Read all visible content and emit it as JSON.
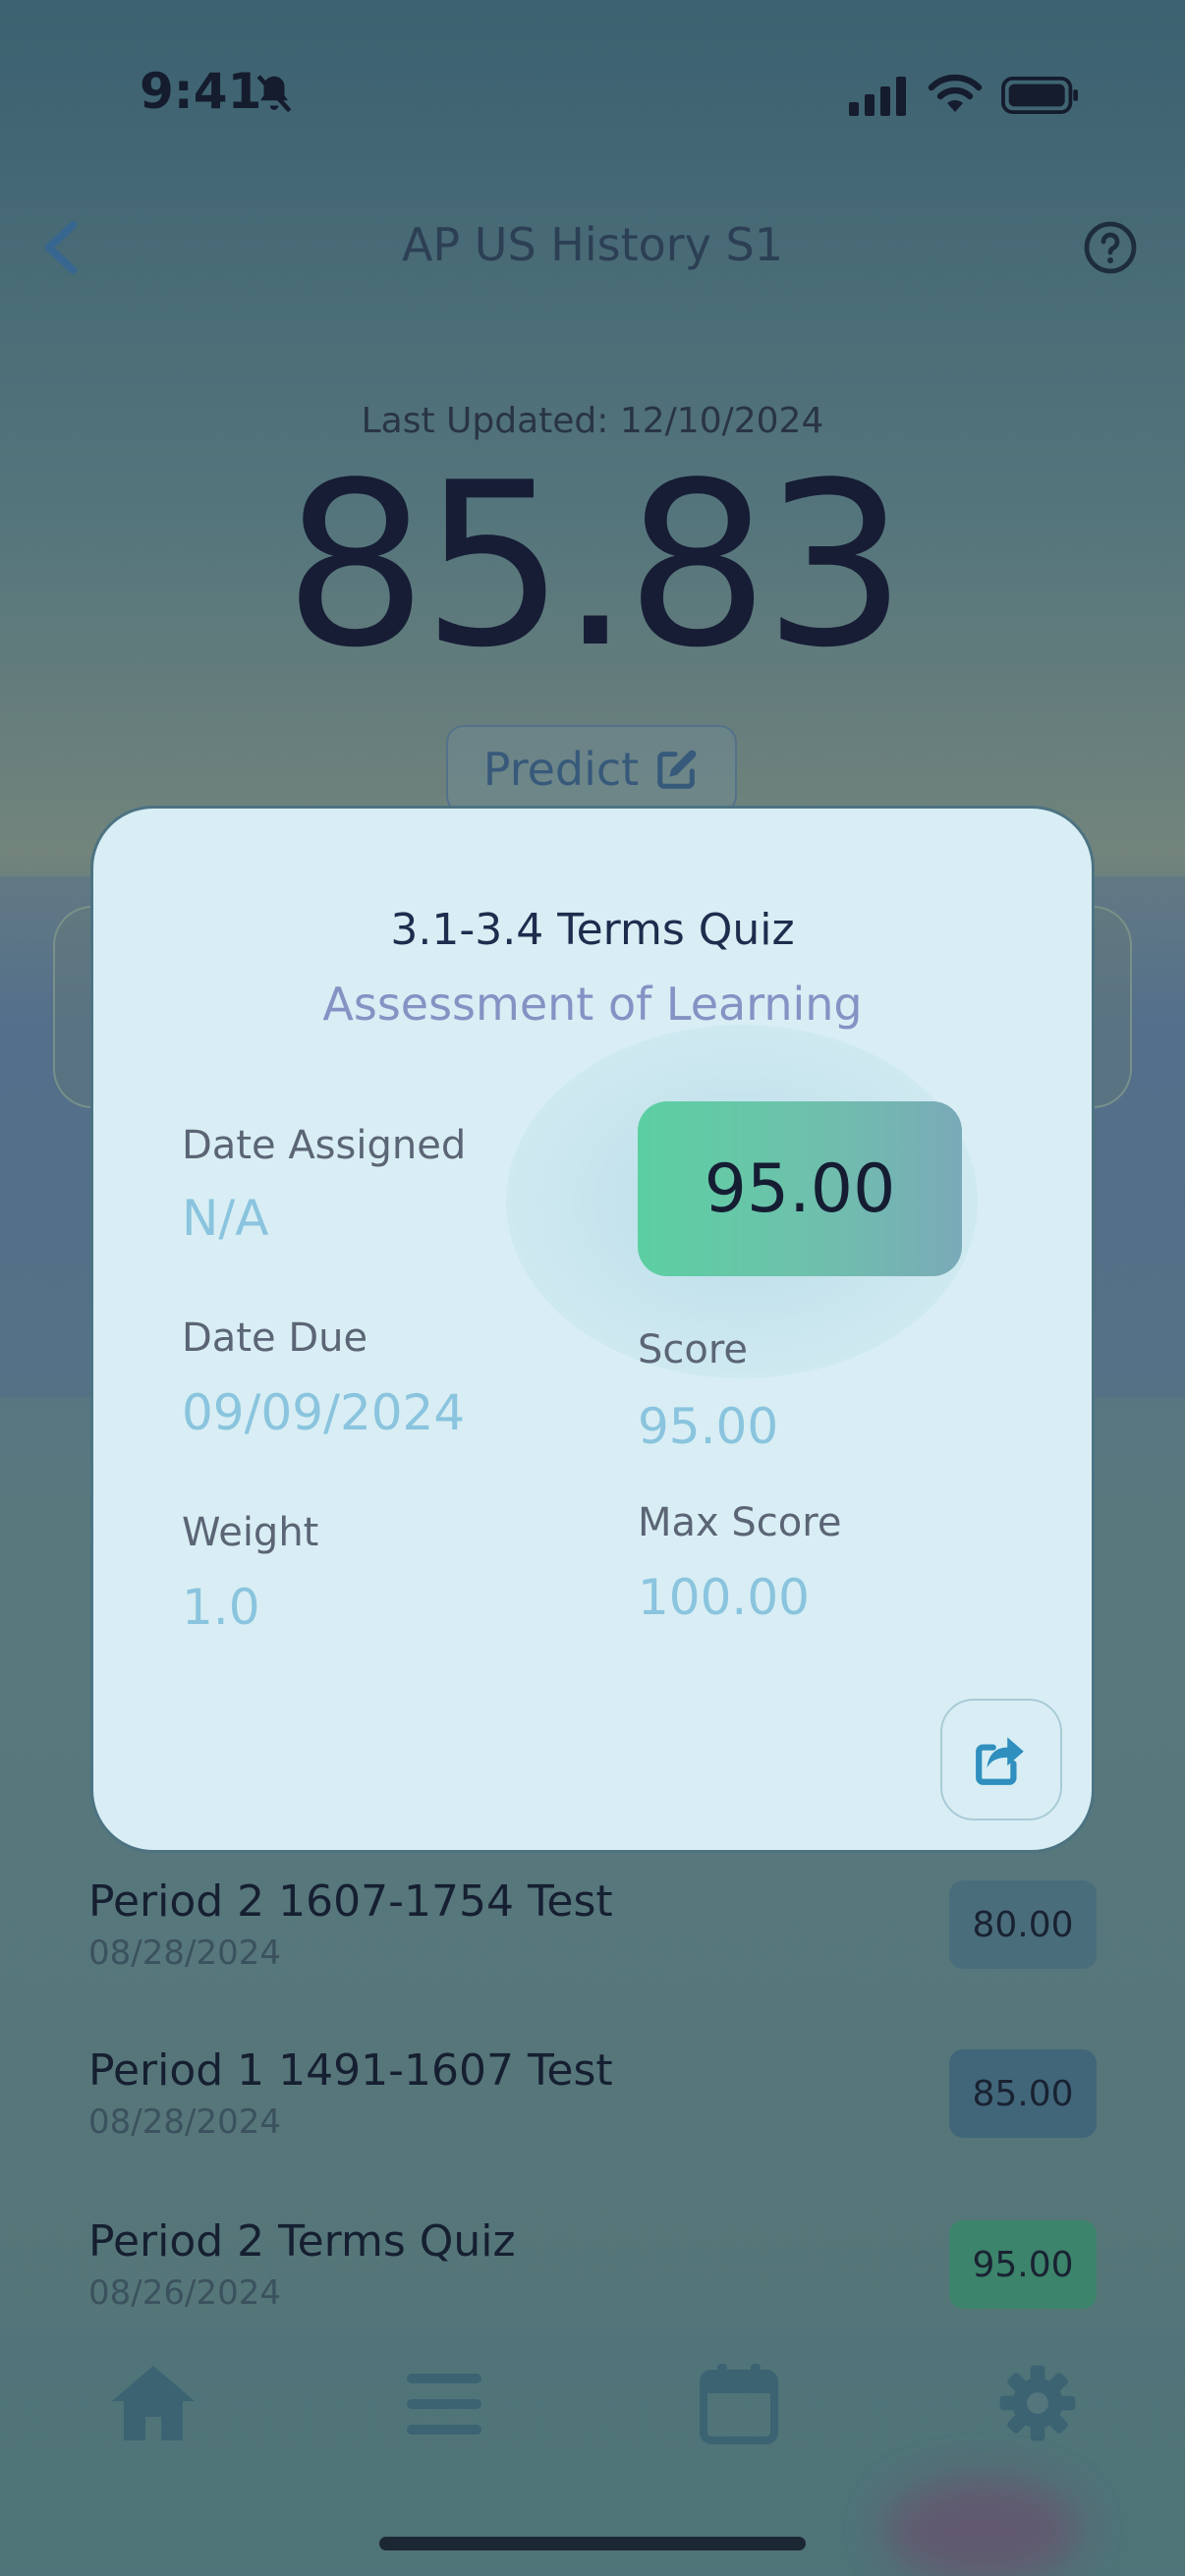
{
  "status_bar": {
    "time": "9:41"
  },
  "header": {
    "title": "AP US History S1"
  },
  "summary": {
    "last_updated": "Last Updated: 12/10/2024",
    "grade": "85.83",
    "predict_label": "Predict"
  },
  "modal": {
    "title": "3.1-3.4 Terms Quiz",
    "subtitle": "Assessment of Learning",
    "score_badge": "95.00",
    "date_assigned_label": "Date Assigned",
    "date_assigned_value": "N/A",
    "date_due_label": "Date Due",
    "date_due_value": "09/09/2024",
    "weight_label": "Weight",
    "weight_value": "1.0",
    "score_label": "Score",
    "score_value": "95.00",
    "max_score_label": "Max Score",
    "max_score_value": "100.00"
  },
  "assignments": [
    {
      "name": "Period 2 1607-1754 Test",
      "date": "08/28/2024",
      "score": "80.00",
      "color": "#4f7180"
    },
    {
      "name": "Period 1 1491-1607 Test",
      "date": "08/28/2024",
      "score": "85.00",
      "color": "#456a7e"
    },
    {
      "name": "Period 2 Terms Quiz",
      "date": "08/26/2024",
      "score": "95.00",
      "color": "#3f8a6e"
    }
  ],
  "nav": {
    "items": [
      "home-icon",
      "list-icon",
      "calendar-icon",
      "gear-icon"
    ]
  },
  "colors": {
    "accent": "#3a5c7e",
    "modal_bg": "#d8eef4",
    "value_text": "#8ac4de",
    "subtitle": "#8592c4"
  }
}
